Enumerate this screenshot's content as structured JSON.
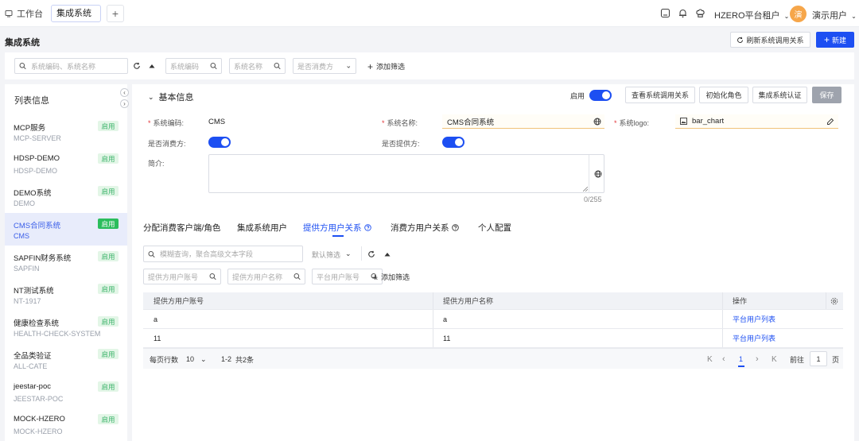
{
  "topbar": {
    "workbench_tab": "工作台",
    "active_tab": "集成系统",
    "tenant": "HZERO平台租户",
    "avatar_text": "演",
    "user_name": "演示用户"
  },
  "header": {
    "page_title": "集成系统",
    "refresh_button": "刷新系统调用关系",
    "new_button": "新建"
  },
  "filters": {
    "main_search_placeholder": "系统编码、系统名称",
    "code_placeholder": "系统编码",
    "name_placeholder": "系统名称",
    "consumer_select": "是否消费方",
    "add_filter": "添加筛选"
  },
  "sidebar": {
    "title": "列表信息",
    "items": [
      {
        "name": "MCP服务",
        "code": "MCP-SERVER",
        "status": "启用"
      },
      {
        "name": "HDSP-DEMO",
        "code": "HDSP-DEMO",
        "status": "启用"
      },
      {
        "name": "DEMO系统",
        "code": "DEMO",
        "status": "启用"
      },
      {
        "name": "CMS合同系统",
        "code": "CMS",
        "status": "启用"
      },
      {
        "name": "SAPFIN财务系统",
        "code": "SAPFIN",
        "status": "启用"
      },
      {
        "name": "NT测试系统",
        "code": "NT-1917",
        "status": "启用"
      },
      {
        "name": "健康检查系统",
        "code": "HEALTH-CHECK-SYSTEM",
        "status": "启用"
      },
      {
        "name": "全品类验证",
        "code": "ALL-CATE",
        "status": "启用"
      },
      {
        "name": "jeestar-poc",
        "code": "JEESTAR-POC",
        "status": "启用"
      },
      {
        "name": "MOCK-HZERO",
        "code": "MOCK-HZERO",
        "status": "启用"
      }
    ]
  },
  "basic": {
    "section_title": "基本信息",
    "enable_label": "启用",
    "btn_view_relations": "查看系统调用关系",
    "btn_init_roles": "初始化角色",
    "btn_auth": "集成系统认证",
    "btn_save": "保存",
    "code_label": "系统编码:",
    "code_value": "CMS",
    "name_label": "系统名称:",
    "name_value": "CMS合同系统",
    "logo_label": "系统logo:",
    "logo_value": "bar_chart",
    "is_consumer_label": "是否消费方:",
    "is_provider_label": "是否提供方:",
    "intro_label": "简介:",
    "counter": "0/255"
  },
  "tabs": [
    {
      "label": "分配消费客户端/角色"
    },
    {
      "label": "集成系统用户"
    },
    {
      "label": "提供方用户关系"
    },
    {
      "label": "消费方用户关系"
    },
    {
      "label": "个人配置"
    }
  ],
  "subfilters": {
    "fuzzy_placeholder": "模糊查询，聚合高级文本字段",
    "default_filter": "默认筛选",
    "provider_account_placeholder": "提供方用户账号",
    "provider_name_placeholder": "提供方用户名称",
    "platform_account_placeholder": "平台用户账号",
    "add_filter": "添加筛选"
  },
  "table": {
    "columns": [
      "提供方用户账号",
      "提供方用户名称",
      "操作"
    ],
    "rows": [
      {
        "account": "a",
        "name": "a",
        "action": "平台用户列表"
      },
      {
        "account": "11",
        "name": "11",
        "action": "平台用户列表"
      }
    ]
  },
  "pagination": {
    "page_size_label": "每页行数",
    "page_size": "10",
    "range": "1-2",
    "total": "共2条",
    "current_page": "1",
    "goto_label": "前往",
    "goto_value": "1",
    "page_unit": "页"
  },
  "colors": {
    "primary": "#1d4ff2",
    "success": "#2bbd5c",
    "required": "#e2373b"
  }
}
